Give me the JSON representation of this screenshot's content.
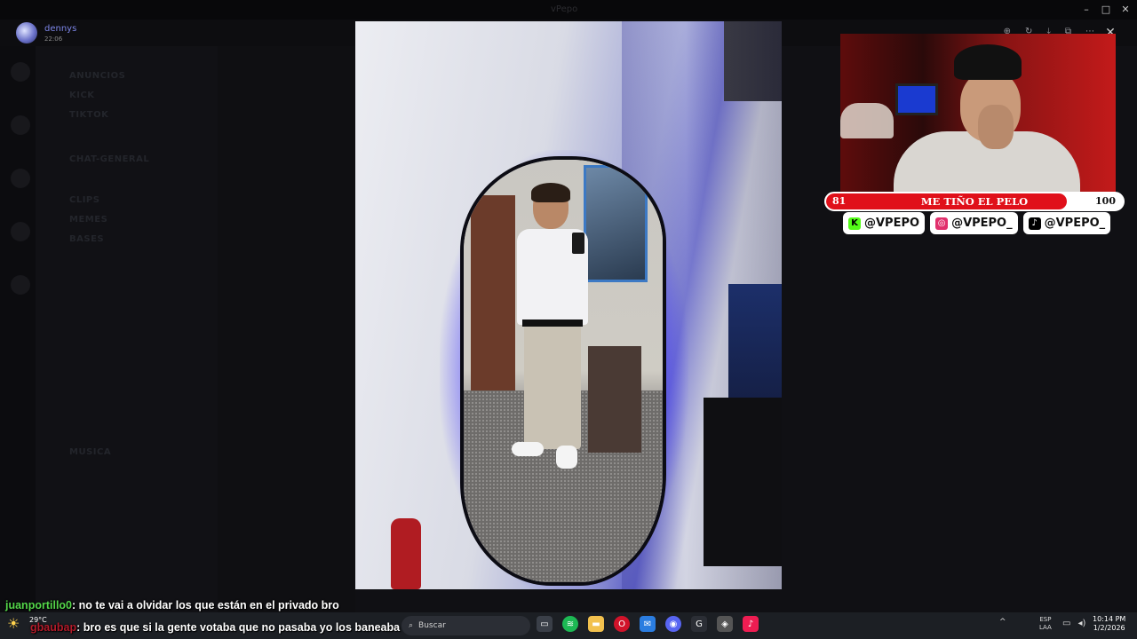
{
  "window": {
    "title": "vPepo"
  },
  "viewer": {
    "user": "dennys",
    "time": "22:06",
    "tools": [
      "zoom-in-icon",
      "rotate-icon",
      "download-icon",
      "open-external-icon",
      "more-icon"
    ],
    "close_icon": "close-icon"
  },
  "server": {
    "channels": [
      "ANUNCIOS",
      "KICK",
      "TIKTOK",
      "CHAT-GENERAL",
      "CLIPS",
      "MEMES",
      "BASES",
      "MUSICA"
    ]
  },
  "stream_overlay": {
    "goal": {
      "start": "81",
      "label": "ME TIÑO EL PELO",
      "end": "100",
      "progress": 0.81
    },
    "socials": [
      {
        "platform": "kick-icon",
        "handle": "@VPEPO",
        "color": "#53fc18"
      },
      {
        "platform": "instagram-icon",
        "handle": "@VPEPO_",
        "color": "#e1306c"
      },
      {
        "platform": "tiktok-icon",
        "handle": "@VPEPO_",
        "color": "#000000"
      }
    ]
  },
  "chat": [
    {
      "user": "juanportillo0",
      "message": ": no te vai a olvidar los que están en el privado bro"
    },
    {
      "user": "gbaubap",
      "message": ": bro es que si la gente votaba que no pasaba yo los baneaba"
    }
  ],
  "taskbar": {
    "weather": {
      "temp": "29°C"
    },
    "search_placeholder": "Buscar",
    "apps": [
      "file-explorer-icon",
      "spotify-icon",
      "folder-icon",
      "opera-icon",
      "email-icon",
      "discord-icon",
      "kick-icon",
      "game-icon",
      "tiktok-icon"
    ],
    "language": {
      "line1": "ESP",
      "line2": "LAA"
    },
    "clock": {
      "time": "10:14 PM",
      "date": "1/2/2026"
    }
  },
  "colors": {
    "accent_red": "#e0101a",
    "kick_green": "#53fc18",
    "chat_green": "#54d64a"
  }
}
